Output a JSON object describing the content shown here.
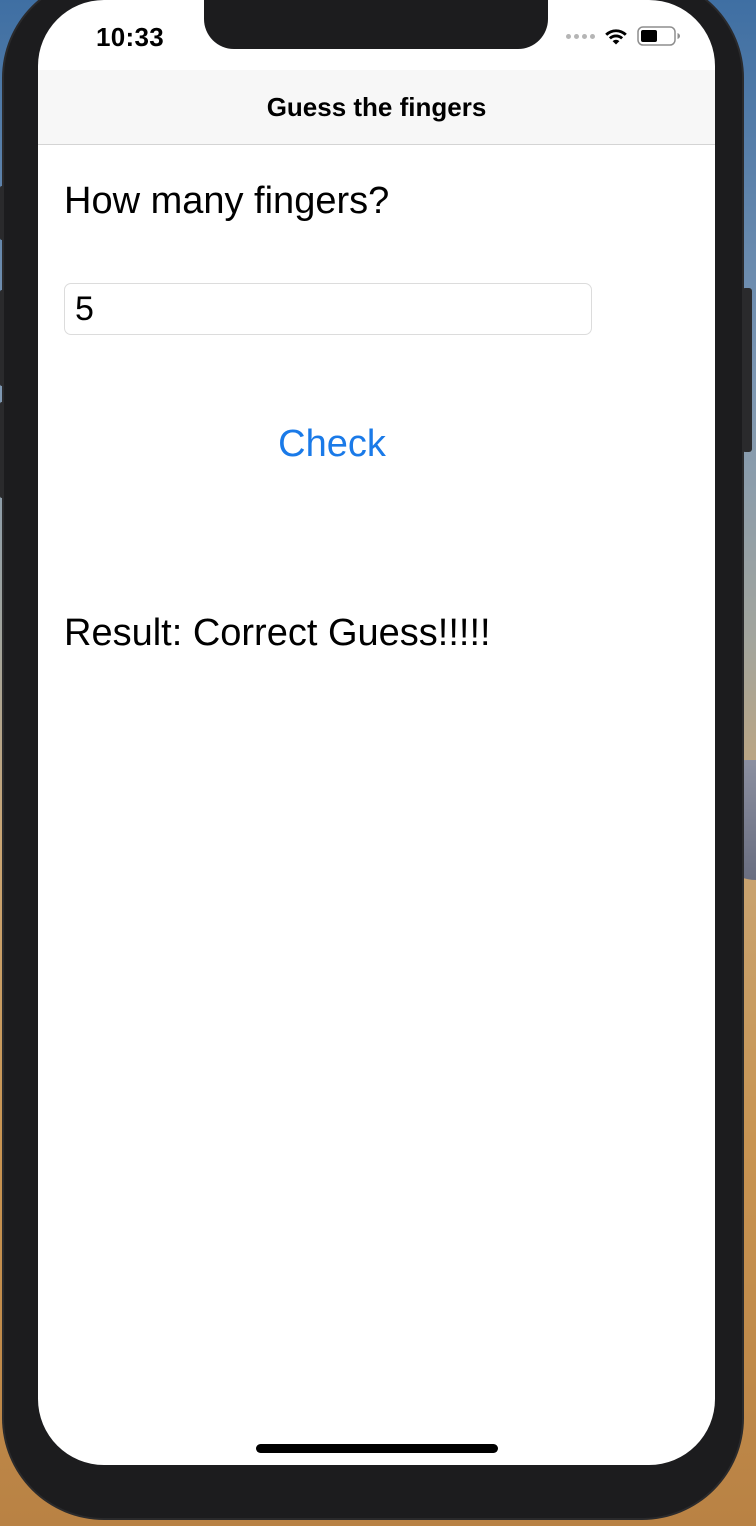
{
  "status_bar": {
    "time": "10:33",
    "icons": [
      "cellular-signal-icon",
      "wifi-icon",
      "battery-icon"
    ]
  },
  "nav": {
    "title": "Guess the fingers"
  },
  "form": {
    "question": "How many fingers?",
    "guess_value": "5",
    "check_label": "Check"
  },
  "result": {
    "text": "Result: Correct Guess!!!!!"
  },
  "colors": {
    "accent": "#1a7ae8",
    "device_frame": "#1c1c1e",
    "nav_background": "#f7f7f7"
  }
}
